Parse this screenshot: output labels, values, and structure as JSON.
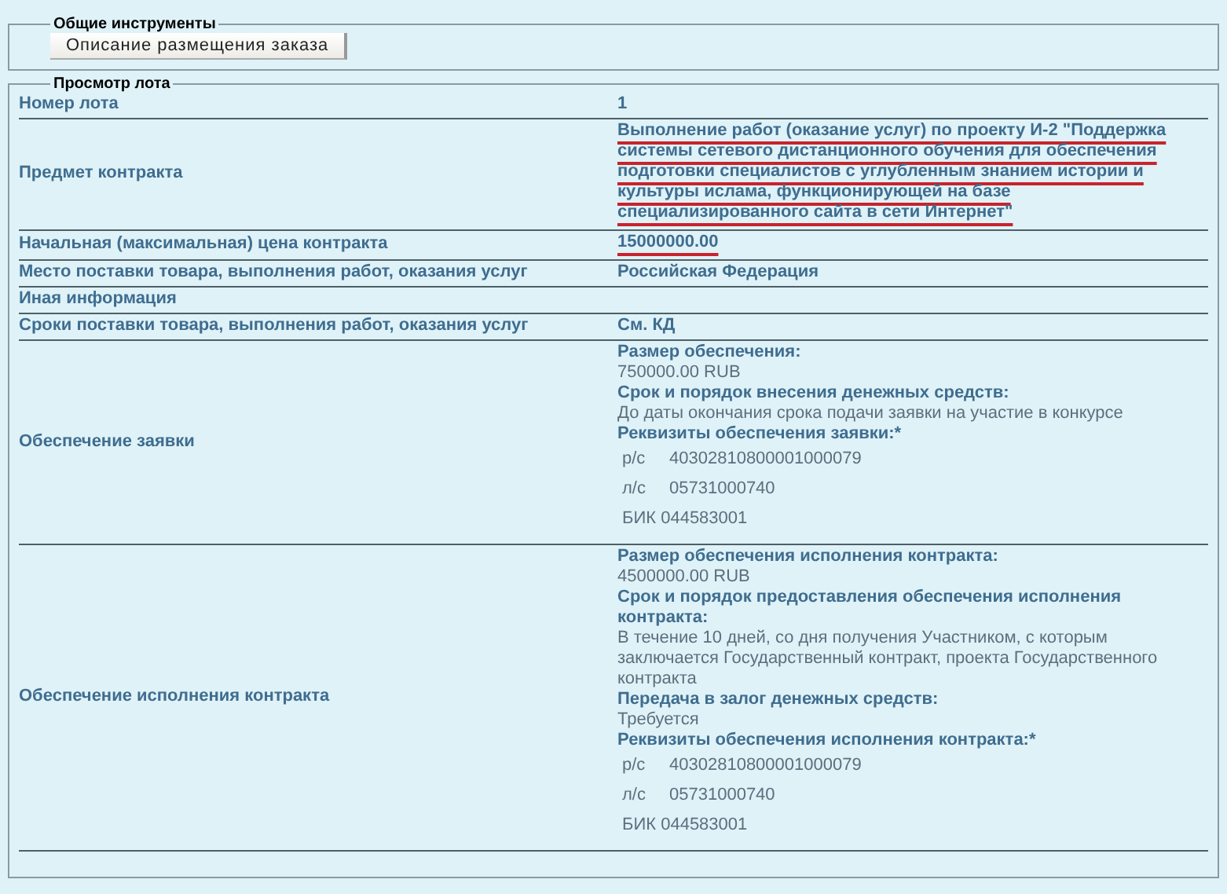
{
  "tools": {
    "legend": "Общие инструменты",
    "button": "Описание размещения заказа"
  },
  "lot": {
    "legend": "Просмотр лота",
    "rows": [
      {
        "label": "Номер лота",
        "kind": "value",
        "value": "1"
      },
      {
        "label": "Предмет контракта",
        "kind": "value",
        "value": "Выполнение работ (оказание услуг) по проекту И-2 \"Поддержка системы сетевого дистанционного обучения для обеспечения подготовки специалистов с углубленным знанием истории и культуры ислама, функционирующей на базе специализированного сайта в сети Интернет\"",
        "marked": true
      },
      {
        "label": "Начальная (максимальная) цена контракта",
        "kind": "value",
        "value": "15000000.00",
        "marked": true
      },
      {
        "label": "Место поставки товара, выполнения работ, оказания услуг",
        "kind": "value",
        "value": "Российская Федерация"
      },
      {
        "label": "Иная информация",
        "kind": "value"
      },
      {
        "label": "Сроки поставки товара, выполнения работ, оказания услуг",
        "kind": "value",
        "value": "См. КД"
      },
      {
        "label": "Обеспечение заявки",
        "kind": "details",
        "items": [
          {
            "kind": "heading",
            "text": "Размер обеспечения:"
          },
          {
            "kind": "text",
            "text": "750000.00 RUB"
          },
          {
            "kind": "heading",
            "text": "Срок и порядок внесения денежных средств:"
          },
          {
            "kind": "text",
            "text": "До даты окончания срока подачи заявки на участие в конкурсе"
          },
          {
            "kind": "heading",
            "text": "Реквизиты обеспечения заявки:*"
          },
          {
            "kind": "account",
            "prefix": "р/с",
            "text": "40302810800001000079"
          },
          {
            "kind": "account",
            "prefix": "л/с",
            "text": "05731000740"
          },
          {
            "kind": "account",
            "text": "БИК 044583001"
          }
        ]
      },
      {
        "label": "Обеспечение исполнения контракта",
        "kind": "details",
        "items": [
          {
            "kind": "heading",
            "text": "Размер обеспечения исполнения контракта:"
          },
          {
            "kind": "text",
            "text": "4500000.00 RUB"
          },
          {
            "kind": "heading",
            "text": "Срок и порядок предоставления обеспечения исполнения контракта:"
          },
          {
            "kind": "text",
            "text": "В течение 10 дней, со дня получения Участником, с которым заключается Государственный контракт, проекта Государственного контракта"
          },
          {
            "kind": "heading",
            "text": "Передача в залог денежных средств:"
          },
          {
            "kind": "text",
            "text": "Требуется"
          },
          {
            "kind": "heading",
            "text": "Реквизиты обеспечения исполнения контракта:*"
          },
          {
            "kind": "account",
            "prefix": "р/с",
            "text": "40302810800001000079"
          },
          {
            "kind": "account",
            "prefix": "л/с",
            "text": "05731000740"
          },
          {
            "kind": "account",
            "text": "БИК 044583001"
          }
        ]
      }
    ]
  }
}
